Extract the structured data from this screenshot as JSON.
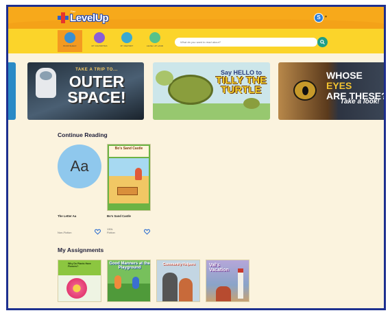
{
  "header": {
    "logo_small": "Raz",
    "logo_text": "LevelUp",
    "avatar_initial": "S",
    "avatar_caret": "▾"
  },
  "nav": {
    "items": [
      {
        "label": "Bookshelf",
        "icon": "bookshelf-icon",
        "color": "#3a8fd0",
        "active": true
      },
      {
        "label": "My Favorites",
        "icon": "favorites-icon",
        "color": "#8a5ed6",
        "active": false
      },
      {
        "label": "My Report",
        "icon": "report-icon",
        "color": "#3aa9d1",
        "active": false
      },
      {
        "label": "Level Up Land",
        "icon": "levelup-land-icon",
        "color": "#56c28a",
        "active": false
      }
    ],
    "search_placeholder": "What do you want to read about?"
  },
  "banners": {
    "space_line1": "TAKE A TRIP TO...",
    "space_line2": "OUTER SPACE!",
    "turtle_line1": "Say HELLO to",
    "turtle_line2": "TILLY THE TURTLE",
    "eyes_line1a": "WHOSE ",
    "eyes_line1b": "EYES",
    "eyes_line2": "ARE THESE?",
    "eyes_line3": "Take a look!"
  },
  "continue_reading": {
    "title": "Continue Reading",
    "items": [
      {
        "title": "The Letter Aa",
        "cover_text": "Aa",
        "level": "",
        "genre": "Non-Fiction"
      },
      {
        "title": "Bo's Sand Castle",
        "cover_text": "Bo's Sand Castle",
        "level": "130L",
        "genre": "Fiction"
      }
    ]
  },
  "assignments": {
    "title": "My Assignments",
    "covers": [
      {
        "title": "Why Do Plants Have Flowers?"
      },
      {
        "title": "Good Manners at the Playground"
      },
      {
        "title": "Community Helpers"
      },
      {
        "title": "Val's Vacation"
      }
    ]
  },
  "colors": {
    "header": "#f7a91b",
    "navbar": "#fbd42a",
    "page_bg": "#fbf3de",
    "frame_border": "#1d2f8f",
    "accent_teal": "#1e9e86"
  }
}
